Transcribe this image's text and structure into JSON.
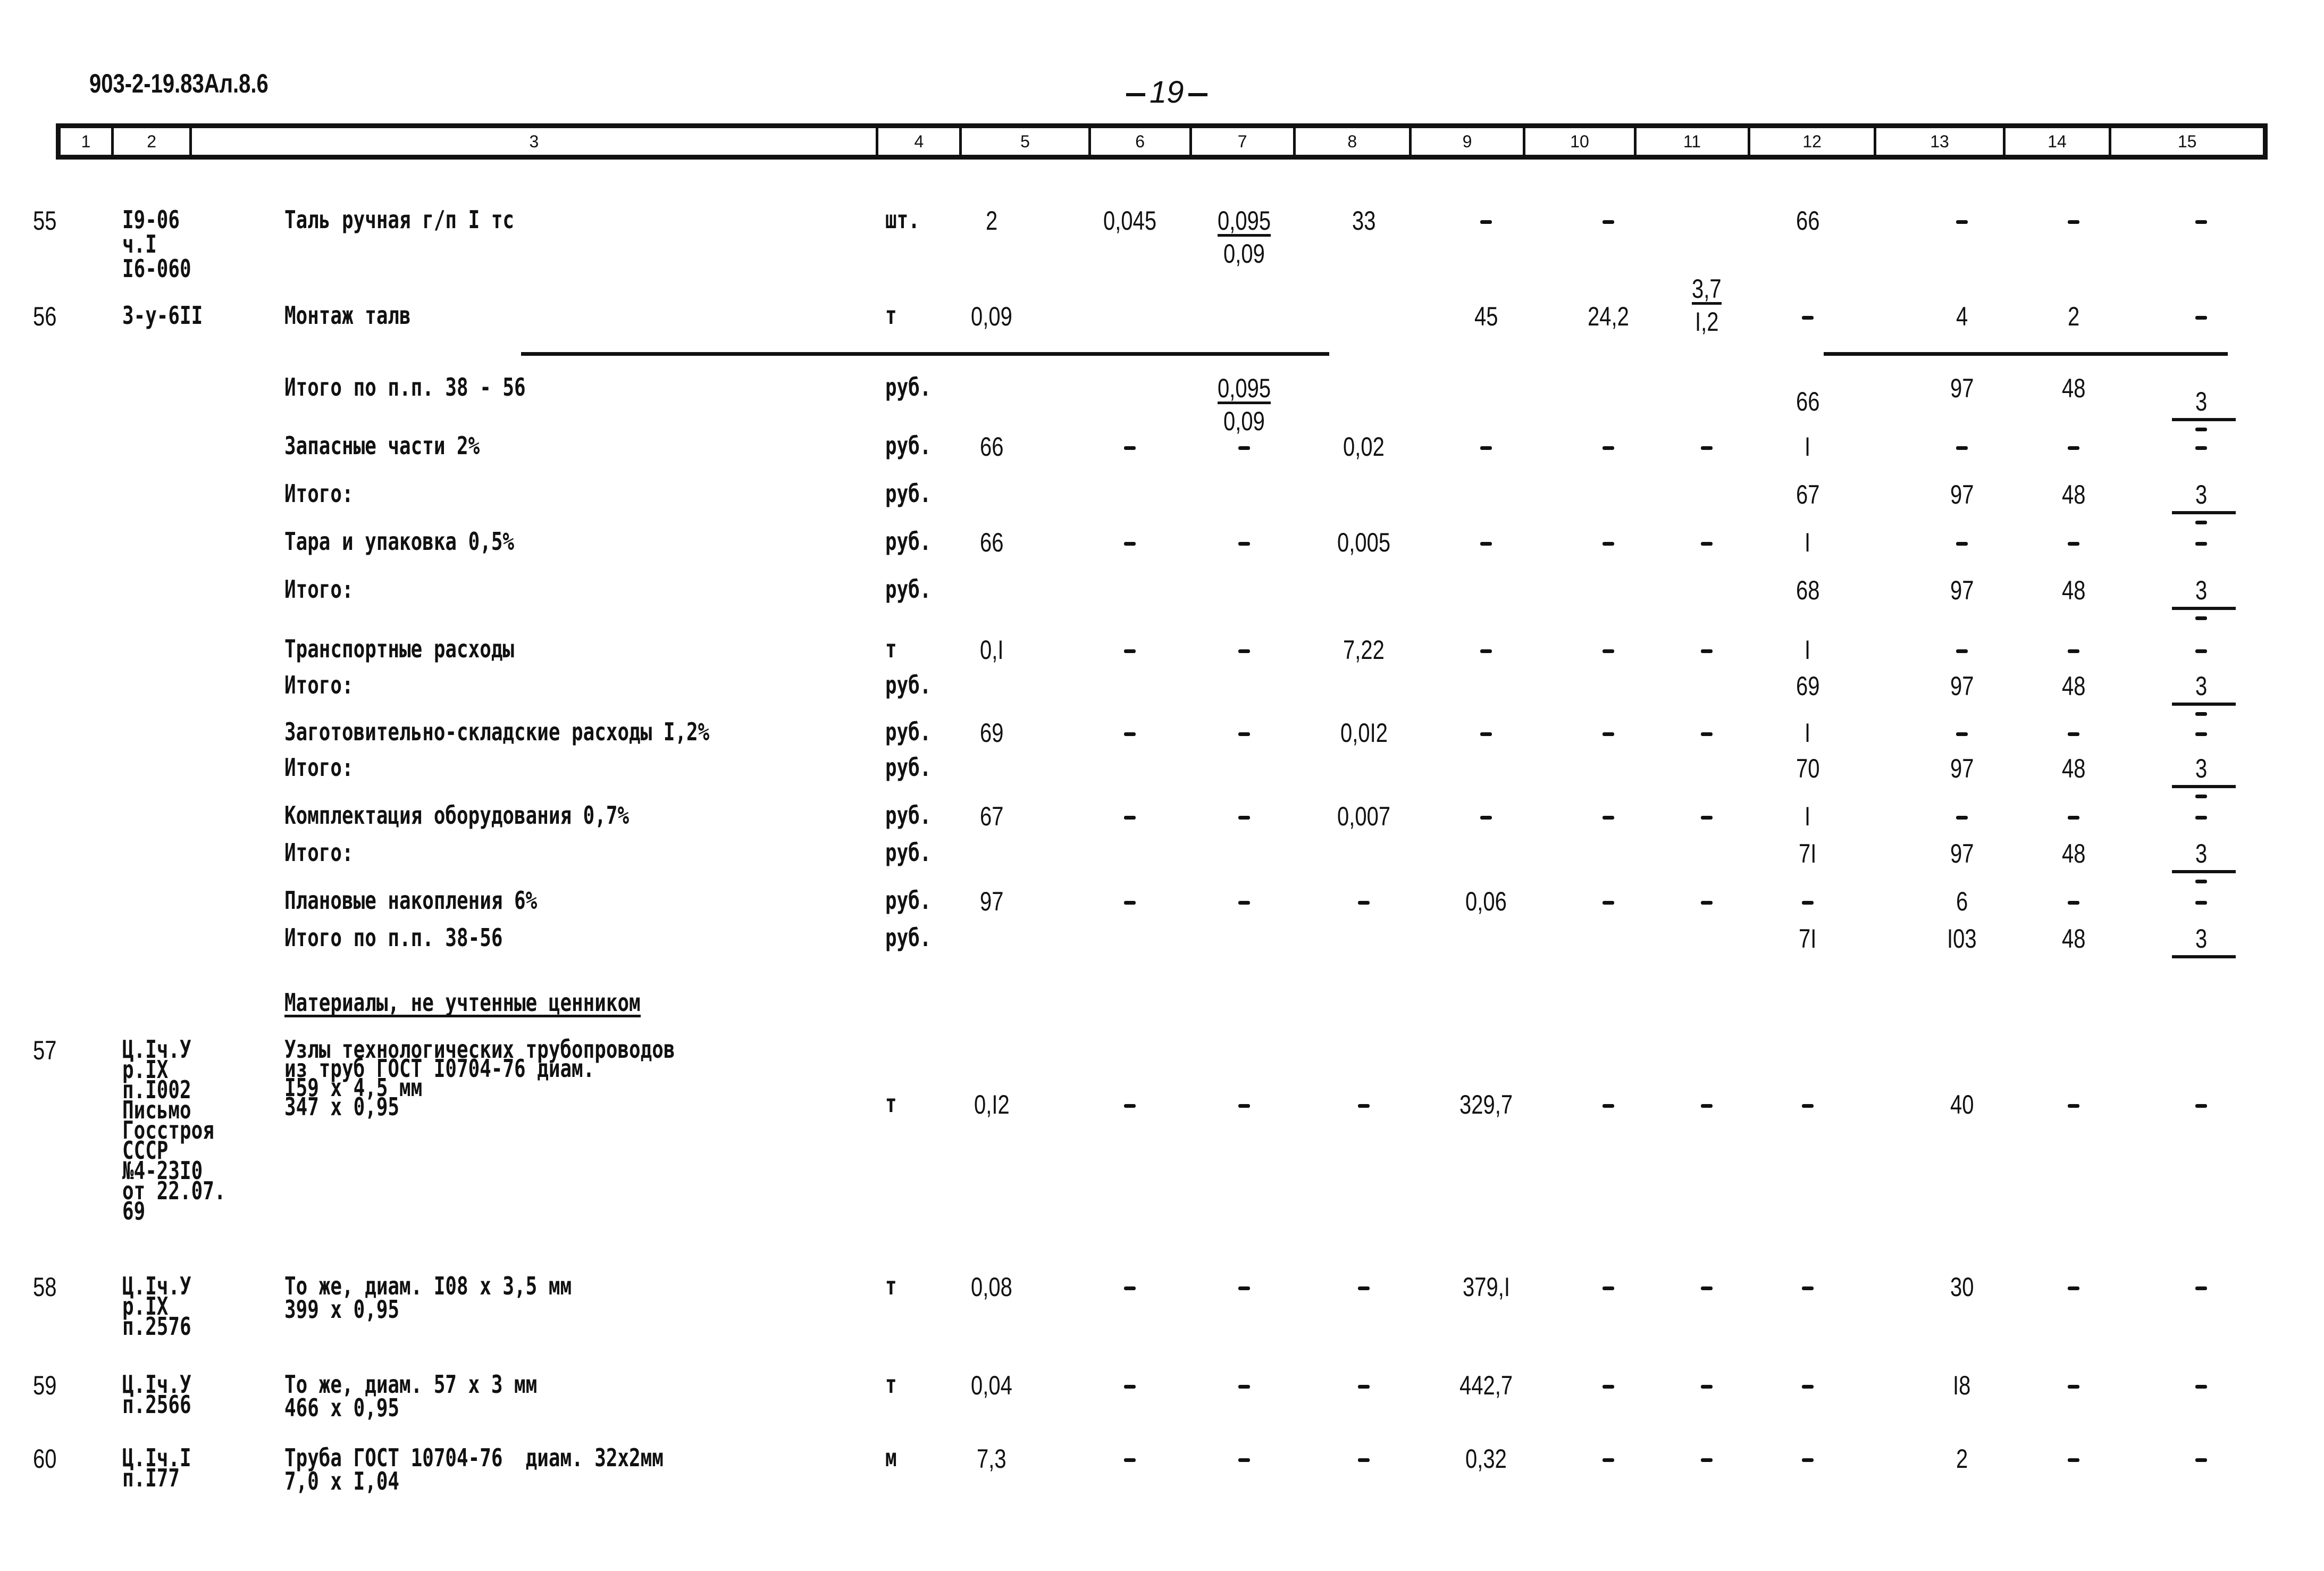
{
  "header": {
    "doc_code": "903-2-19.83Ал.8.6",
    "page_number": "19",
    "columns": [
      "1",
      "2",
      "3",
      "4",
      "5",
      "6",
      "7",
      "8",
      "9",
      "10",
      "11",
      "12",
      "13",
      "14",
      "15"
    ]
  },
  "rows": [
    {
      "no": "55",
      "ref": [
        "I9-06",
        "ч.I",
        "I6-060"
      ],
      "name": [
        "Таль ручная г/п I тс"
      ],
      "unit": "шт.",
      "c5": "2",
      "c6": "0,045",
      "c7_top": "0,095",
      "c7_bottom": "0,09",
      "c8": "33",
      "c9": "–",
      "c10": "–",
      "c11": "–",
      "c12": "66",
      "c13": "–",
      "c14": "–",
      "c15": "–"
    },
    {
      "no": "56",
      "ref": [
        "3-у-6II"
      ],
      "name": [
        "Монтаж талв"
      ],
      "unit": "т",
      "c5": "0,09",
      "c9": "45",
      "c10": "24,2",
      "c11_top": "3,7",
      "c11_bottom": "I,2",
      "c12": "–",
      "c13": "4",
      "c14": "2",
      "c15": "–"
    }
  ],
  "subtotals": [
    {
      "label": "Итого по п.п. 38 - 56",
      "unit": "руб.",
      "c7_top": "0,095",
      "c7_bottom": "0,09",
      "c12": "66",
      "c13": "97",
      "c14": "48",
      "c15": "3"
    },
    {
      "label": "Запасные части 2%",
      "unit": "руб.",
      "c5": "66",
      "c6": "–",
      "c7": "–",
      "c8": "0,02",
      "c9": "–",
      "c10": "–",
      "c11": "–",
      "c12": "I",
      "c13": "–",
      "c14": "–",
      "c15": "–"
    },
    {
      "label": "Итого:",
      "unit": "руб.",
      "c12": "67",
      "c13": "97",
      "c14": "48",
      "c15": "3"
    },
    {
      "label": "Тара и упаковка 0,5%",
      "unit": "руб.",
      "c5": "66",
      "c6": "–",
      "c7": "–",
      "c8": "0,005",
      "c9": "–",
      "c10": "–",
      "c11": "–",
      "c12": "I",
      "c13": "–",
      "c14": "–",
      "c15": "–"
    },
    {
      "label": "Итого:",
      "unit": "руб.",
      "c12": "68",
      "c13": "97",
      "c14": "48",
      "c15": "3"
    },
    {
      "label": "Транспортные расходы",
      "unit": "т",
      "c5": "0,I",
      "c6": "–",
      "c7": "–",
      "c8": "7,22",
      "c9": "–",
      "c10": "–",
      "c11": "–",
      "c12": "I",
      "c13": "–",
      "c14": "–",
      "c15": "–"
    },
    {
      "label": "Итого:",
      "unit": "руб.",
      "c12": "69",
      "c13": "97",
      "c14": "48",
      "c15": "3"
    },
    {
      "label": "Заготовительно-складские расходы I,2%",
      "unit": "руб.",
      "c5": "69",
      "c6": "–",
      "c7": "–",
      "c8": "0,0I2",
      "c9": "–",
      "c10": "–",
      "c11": "–",
      "c12": "I",
      "c13": "–",
      "c14": "–",
      "c15": "–"
    },
    {
      "label": "Итого:",
      "unit": "руб.",
      "c12": "70",
      "c13": "97",
      "c14": "48",
      "c15": "3"
    },
    {
      "label": "Комплектация оборудования 0,7%",
      "unit": "руб.",
      "c5": "67",
      "c6": "–",
      "c7": "–",
      "c8": "0,007",
      "c9": "–",
      "c10": "–",
      "c11": "–",
      "c12": "I",
      "c13": "–",
      "c14": "–",
      "c15": "–"
    },
    {
      "label": "Итого:",
      "unit": "руб.",
      "c12": "7I",
      "c13": "97",
      "c14": "48",
      "c15": "3"
    },
    {
      "label": "Плановые накопления 6%",
      "unit": "руб.",
      "c5": "97",
      "c6": "–",
      "c7": "–",
      "c8": "–",
      "c9": "0,06",
      "c10": "–",
      "c11": "–",
      "c12": "–",
      "c13": "6",
      "c14": "–",
      "c15": "–"
    },
    {
      "label": "Итого по п.п. 38-56",
      "unit": "руб.",
      "c12": "7I",
      "c13": "I03",
      "c14": "48",
      "c15": "3"
    }
  ],
  "section_title": "Материалы, не учтенные ценником",
  "materials": [
    {
      "no": "57",
      "ref": [
        "Ц.Iч.У",
        "р.IX",
        "п.I002",
        "Письмо",
        "Госстроя",
        "СССР",
        "№4-23I0",
        "от 22.07.",
        "69"
      ],
      "name": [
        "Узлы технологических трубопроводов",
        "из труб ГОСТ I0704-76 диам.",
        "I59 х 4,5 мм",
        "347 х 0,95"
      ],
      "unit": "т",
      "c5": "0,I2",
      "c6": "–",
      "c7": "–",
      "c8": "–",
      "c9": "329,7",
      "c10": "–",
      "c11": "–",
      "c12": "–",
      "c13": "40",
      "c14": "–",
      "c15": "–"
    },
    {
      "no": "58",
      "ref": [
        "Ц.Iч.У",
        "р.IX",
        "п.2576"
      ],
      "name": [
        "То же, диам. I08 х 3,5 мм",
        "399 х 0,95"
      ],
      "unit": "т",
      "c5": "0,08",
      "c6": "–",
      "c7": "–",
      "c8": "–",
      "c9": "379,I",
      "c10": "–",
      "c11": "–",
      "c12": "–",
      "c13": "30",
      "c14": "–",
      "c15": "–"
    },
    {
      "no": "59",
      "ref": [
        "Ц.Iч.У",
        "п.2566"
      ],
      "name": [
        "То же, диам. 57 х 3 мм",
        "466 х 0,95"
      ],
      "unit": "т",
      "c5": "0,04",
      "c6": "–",
      "c7": "–",
      "c8": "–",
      "c9": "442,7",
      "c10": "–",
      "c11": "–",
      "c12": "–",
      "c13": "I8",
      "c14": "–",
      "c15": "–"
    },
    {
      "no": "60",
      "ref": [
        "Ц.Iч.I",
        "п.I77"
      ],
      "name": [
        "Труба ГОСТ 10704-76  диам. 32х2мм",
        "7,0 х I,04"
      ],
      "unit": "м",
      "c5": "7,3",
      "c6": "–",
      "c7": "–",
      "c8": "–",
      "c9": "0,32",
      "c10": "–",
      "c11": "–",
      "c12": "–",
      "c13": "2",
      "c14": "–",
      "c15": "–"
    }
  ]
}
